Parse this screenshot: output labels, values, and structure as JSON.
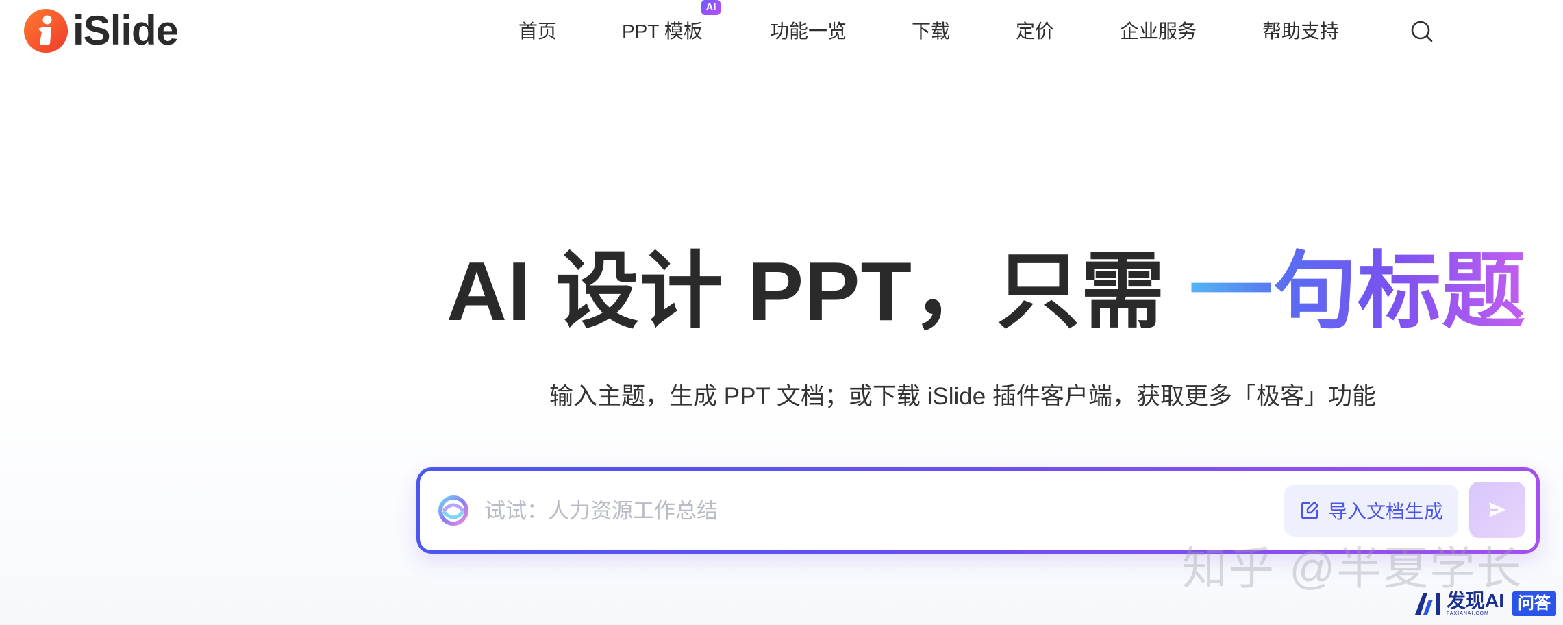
{
  "header": {
    "logo_text": "iSlide",
    "nav": [
      {
        "label": "首页"
      },
      {
        "label": "PPT 模板",
        "badge": "AI"
      },
      {
        "label": "功能一览"
      },
      {
        "label": "下载"
      },
      {
        "label": "定价"
      },
      {
        "label": "企业服务"
      },
      {
        "label": "帮助支持"
      }
    ],
    "search_icon": "search-icon"
  },
  "hero": {
    "title_main": "AI 设计 PPT，只需 ",
    "title_accent": "一句标题",
    "subtitle": "输入主题，生成 PPT 文档；或下载 iSlide 插件客户端，获取更多「极客」功能"
  },
  "prompt": {
    "placeholder": "试试：人力资源工作总结",
    "value": "",
    "import_label": "导入文档生成",
    "send_icon": "send-icon",
    "ai_icon": "ai-swirl-icon"
  },
  "watermarks": {
    "zhihu": "知乎 @半夏学长",
    "faxian_title": "发现AI",
    "faxian_sub": "FAXIANAI.COM",
    "faxian_tag": "问答"
  },
  "colors": {
    "brand_orange": "#f15a2b",
    "accent_purple": "#7a52f0",
    "accent_blue": "#52b6f3",
    "import_text": "#4d55e6"
  }
}
